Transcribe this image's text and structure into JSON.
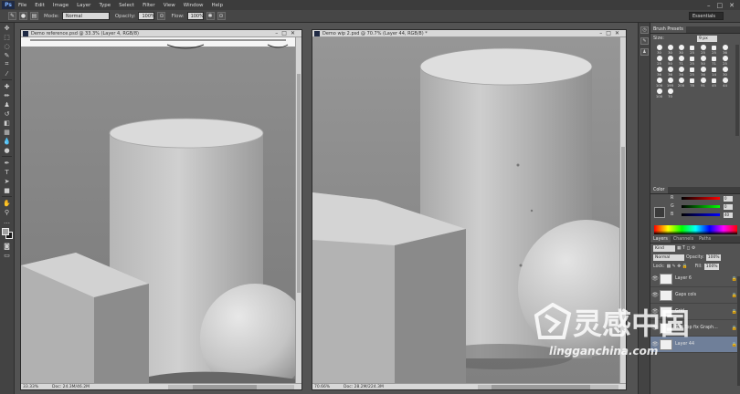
{
  "app": {
    "logo": "Ps",
    "menu": [
      "File",
      "Edit",
      "Image",
      "Layer",
      "Type",
      "Select",
      "Filter",
      "View",
      "Window",
      "Help"
    ],
    "window_controls": [
      "–",
      "□",
      "✕"
    ]
  },
  "options_bar": {
    "mode_label": "Mode:",
    "mode_value": "Normal",
    "opacity_label": "Opacity:",
    "opacity_value": "100%",
    "flow_label": "Flow:",
    "flow_value": "100%",
    "workspace": "Essentials"
  },
  "documents": [
    {
      "title": "Demo reference.psd @ 33.3% (Layer 4, RGB/8)",
      "zoom": "33.33%",
      "doc_size": "Doc: 24.3M/46.2M"
    },
    {
      "title": "Demo wip 2.psd @ 70.7% (Layer 44, RGB/8) *",
      "zoom": "70.66%",
      "doc_size": "Doc: 28.2M/224.3M"
    }
  ],
  "brush_panel": {
    "tabs": [
      "Brush Presets"
    ],
    "size_label": "Size:",
    "size_value": "9 px",
    "presets": [
      "30",
      "30",
      "30",
      "25",
      "25",
      "25",
      "36",
      "25",
      "50",
      "71",
      "25",
      "50",
      "71",
      "25",
      "36",
      "36",
      "36",
      "25",
      "36",
      "14",
      "30",
      "100",
      "195",
      "200",
      "78",
      "91",
      "45",
      "44",
      "100",
      "70"
    ]
  },
  "color_panel": {
    "tabs": [
      "Color"
    ],
    "channels": [
      {
        "name": "R",
        "value": "0"
      },
      {
        "name": "G",
        "value": "0"
      },
      {
        "name": "B",
        "value": "40"
      }
    ]
  },
  "layers_panel": {
    "tabs": [
      "Layers",
      "Channels",
      "Paths"
    ],
    "kind_label": "Kind",
    "blend_mode": "Normal",
    "opacity_label": "Opacity:",
    "opacity_value": "100%",
    "lock_label": "Lock:",
    "fill_label": "Fill:",
    "fill_value": "100%",
    "layers": [
      {
        "name": "Layer 6",
        "selected": false
      },
      {
        "name": "Gaps cols",
        "selected": false
      },
      {
        "name": "Grid",
        "selected": false
      },
      {
        "name": "Ball Top fix Graph...",
        "selected": false
      },
      {
        "name": "Layer 44",
        "selected": true
      }
    ]
  },
  "watermark": {
    "text_cn": "灵感中国",
    "url": "lingganchina.com"
  }
}
